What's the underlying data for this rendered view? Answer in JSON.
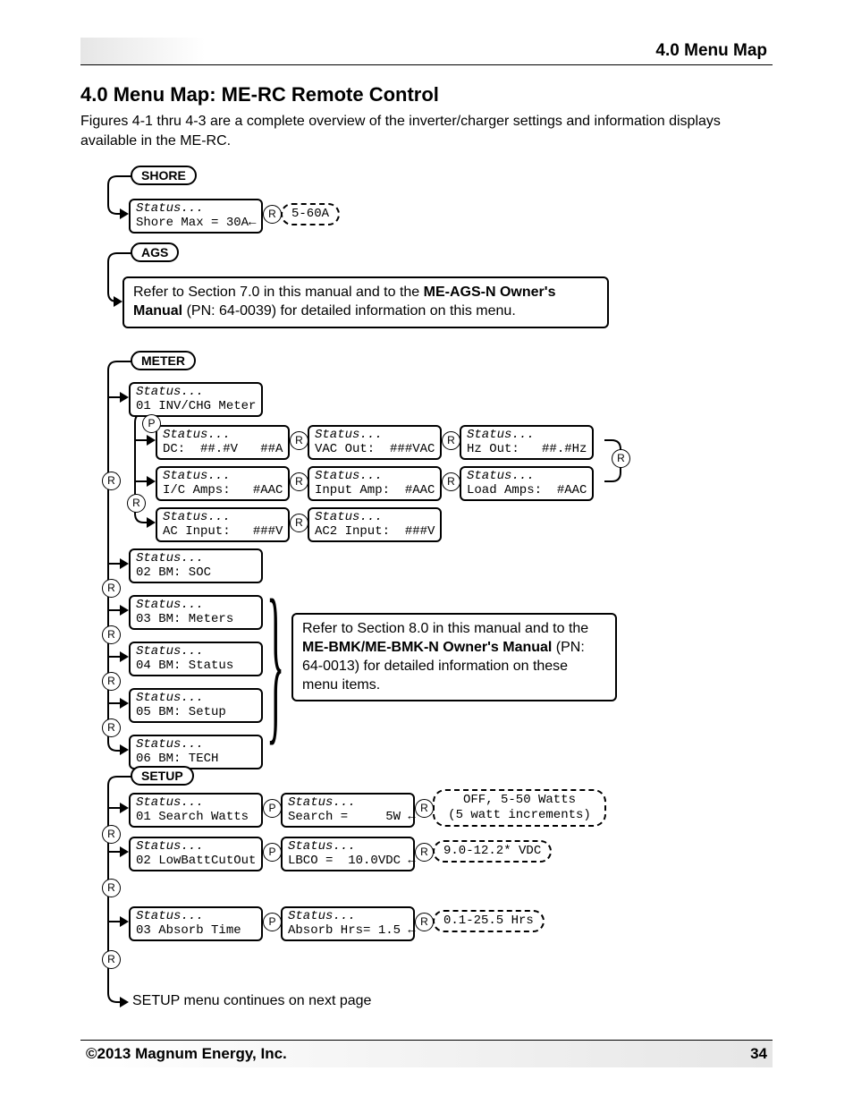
{
  "header": {
    "section_label": "4.0 Menu Map"
  },
  "title": "4.0   Menu Map: ME-RC Remote Control",
  "intro": "Figures 4-1 thru 4-3 are a complete overview of the inverter/charger settings and information displays available in the ME-RC.",
  "buttons": {
    "shore": "SHORE",
    "ags": "AGS",
    "meter": "METER",
    "setup": "SETUP"
  },
  "circ": {
    "R": "R",
    "P": "P"
  },
  "shore": {
    "disp": {
      "status": "Status...",
      "line2": "Shore Max = 30A←"
    },
    "range": "5-60A"
  },
  "ags_note": {
    "pre": "Refer to Section 7.0 in this manual and to the ",
    "bold1": "ME-AGS-N Owner's Manual",
    "post": " (PN: 64-0039) for detailed information on this menu."
  },
  "meter": {
    "m01": {
      "status": "Status...",
      "line2": "01 INV/CHG Meter"
    },
    "row1": {
      "a": {
        "status": "Status...",
        "line2": "DC:  ##.#V   ##A"
      },
      "b": {
        "status": "Status...",
        "line2": "VAC Out:  ###VAC"
      },
      "c": {
        "status": "Status...",
        "line2": "Hz Out:   ##.#Hz"
      }
    },
    "row2": {
      "a": {
        "status": "Status...",
        "line2": "I/C Amps:   #AAC"
      },
      "b": {
        "status": "Status...",
        "line2": "Input Amp:  #AAC"
      },
      "c": {
        "status": "Status...",
        "line2": "Load Amps:  #AAC"
      }
    },
    "row3": {
      "a": {
        "status": "Status...",
        "line2": "AC Input:   ###V"
      },
      "b": {
        "status": "Status...",
        "line2": "AC2 Input:  ###V"
      }
    },
    "m02": {
      "status": "Status...",
      "line2": "02 BM: SOC"
    },
    "m03": {
      "status": "Status...",
      "line2": "03 BM: Meters"
    },
    "m04": {
      "status": "Status...",
      "line2": "04 BM: Status"
    },
    "m05": {
      "status": "Status...",
      "line2": "05 BM: Setup"
    },
    "m06": {
      "status": "Status...",
      "line2": "06 BM: TECH"
    }
  },
  "bm_note": {
    "pre": "Refer to Section 8.0 in this manual and to the ",
    "bold1": "ME-BMK/ME-BMK-N Owner's Manual",
    "post": " (PN: 64-0013) for detailed information on these menu items."
  },
  "setup": {
    "s01": {
      "status": "Status...",
      "line2": "01 Search Watts"
    },
    "s01b": {
      "status": "Status...",
      "line2": "Search =     5W ←"
    },
    "s01r": {
      "l1": "OFF, 5-50 Watts",
      "l2": "(5 watt increments)"
    },
    "s02": {
      "status": "Status...",
      "line2": "02 LowBattCutOut"
    },
    "s02b": {
      "status": "Status...",
      "line2": "LBCO =  10.0VDC ←"
    },
    "s02r": "9.0-12.2* VDC",
    "s03": {
      "status": "Status...",
      "line2": "03 Absorb Time"
    },
    "s03b": {
      "status": "Status...",
      "line2": "Absorb Hrs= 1.5 ←"
    },
    "s03r": "0.1-25.5 Hrs"
  },
  "continue_text": "SETUP menu continues on next page",
  "footer": {
    "left": "©2013 Magnum Energy, Inc.",
    "right": "34"
  }
}
